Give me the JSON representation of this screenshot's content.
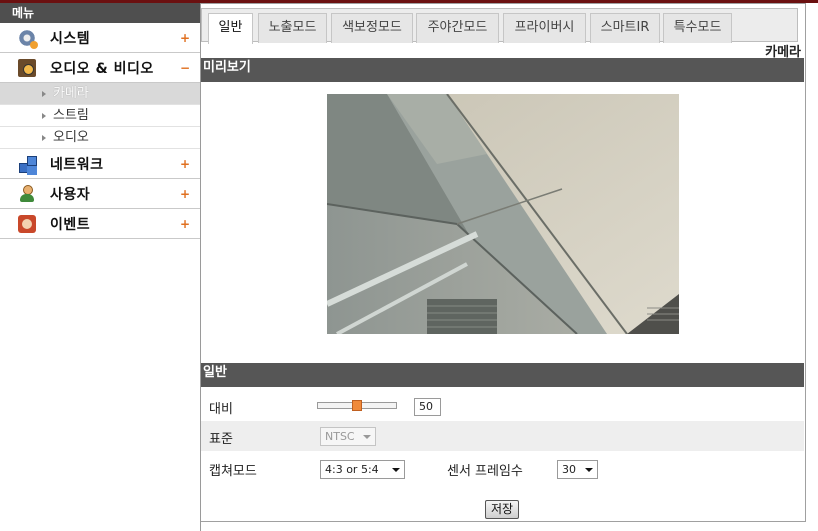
{
  "sidebar": {
    "header": "메뉴",
    "categories": [
      {
        "label": "시스템",
        "sign": "+",
        "icon": "gear-icon"
      },
      {
        "label": "오디오 & 비디오",
        "sign": "−",
        "icon": "audio-video-icon"
      },
      {
        "label": "네트워크",
        "sign": "+",
        "icon": "network-icon"
      },
      {
        "label": "사용자",
        "sign": "+",
        "icon": "user-icon"
      },
      {
        "label": "이벤트",
        "sign": "+",
        "icon": "event-icon"
      }
    ],
    "subitems": [
      {
        "label": "카메라",
        "active": true
      },
      {
        "label": "스트림",
        "active": false
      },
      {
        "label": "오디오",
        "active": false
      }
    ]
  },
  "tabs": [
    "일반",
    "노출모드",
    "색보정모드",
    "주야간모드",
    "프라이버시",
    "스마트IR",
    "특수모드"
  ],
  "active_tab": "일반",
  "page_title": "카메라",
  "sections": {
    "preview": "미리보기",
    "general": "일반"
  },
  "settings": {
    "contrast": {
      "label": "대비",
      "value": "50",
      "slider_fraction": 0.5
    },
    "standard": {
      "label": "표준",
      "value": "NTSC",
      "disabled": true
    },
    "capture_mode": {
      "label": "캡쳐모드",
      "value": "4:3 or 5:4"
    },
    "sensor_frame_rate": {
      "label": "센서 프레임수",
      "value": "30"
    }
  },
  "save_label": "저장",
  "colors": {
    "accent": "#f08a3a",
    "header_bar": "#565656",
    "top_bar": "#6b1010"
  }
}
